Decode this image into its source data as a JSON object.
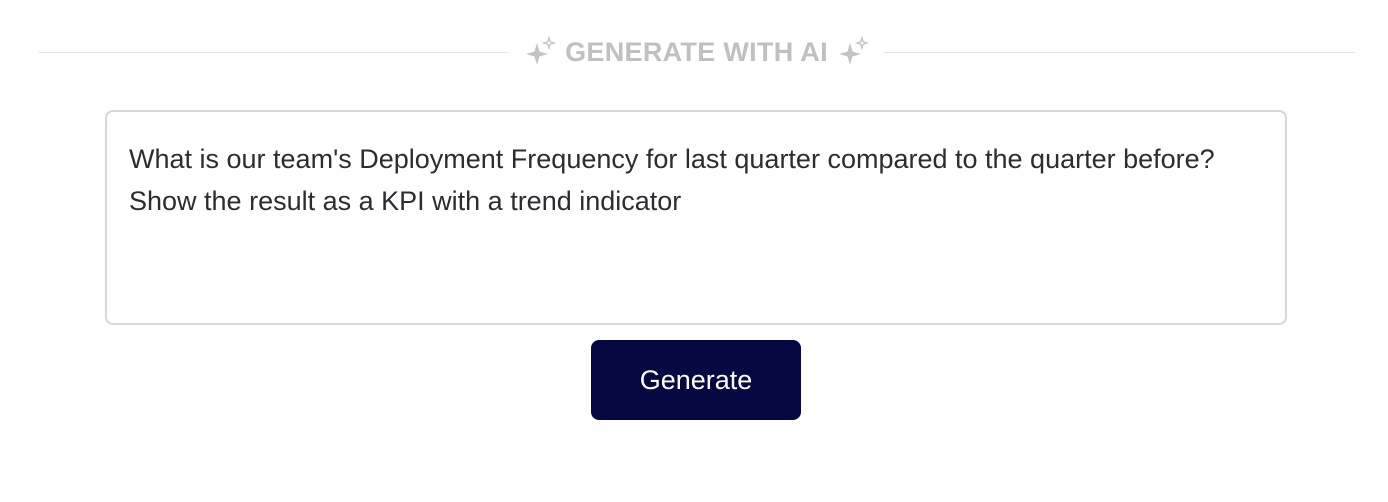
{
  "section": {
    "title": "GENERATE WITH AI",
    "left_icon": "sparkle-icon",
    "right_icon": "sparkle-icon"
  },
  "prompt": {
    "value": "What is our team's Deployment Frequency for last quarter compared to the quarter before? Show the result as a KPI with a trend indicator"
  },
  "actions": {
    "generate_label": "Generate"
  },
  "colors": {
    "button_bg": "#050841",
    "divider_text": "#c0c0c0",
    "border": "#d6d6dc"
  }
}
